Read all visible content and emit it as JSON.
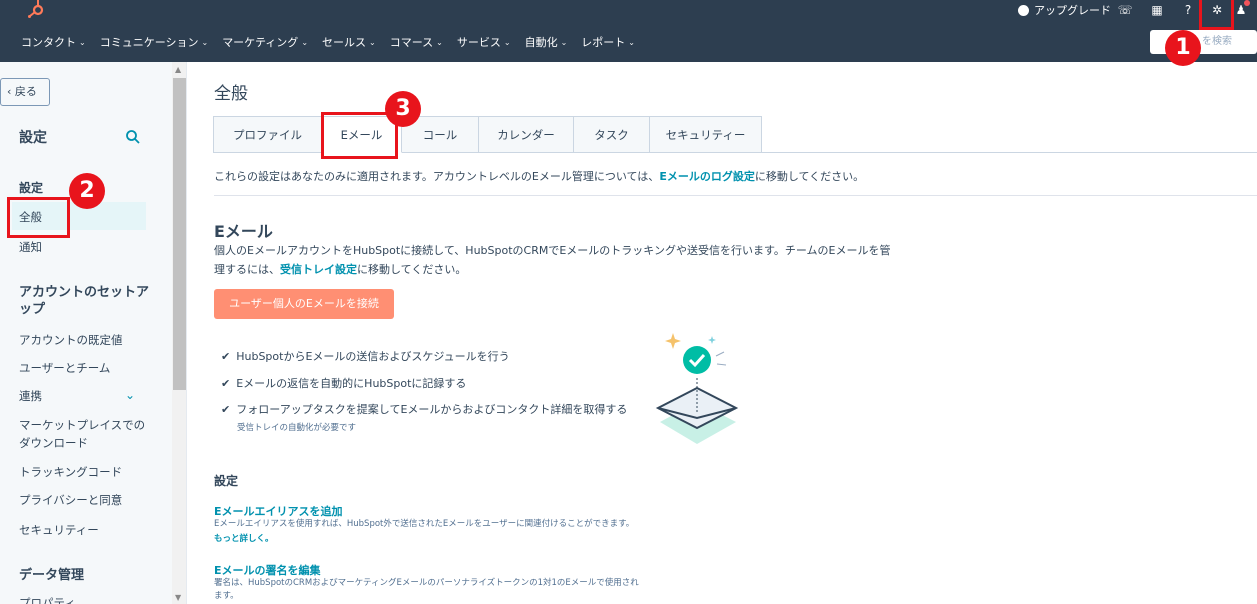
{
  "topbar": {
    "upgrade_label": "アップグレード",
    "search_placeholder": "HubSpotを検索",
    "search_visible": "を検索",
    "nav": [
      "コンタクト",
      "コミュニケーション",
      "マーケティング",
      "セールス",
      "コマース",
      "サービス",
      "自動化",
      "レポート"
    ]
  },
  "sidebar": {
    "back_label": "戻る",
    "title": "設定",
    "section_settings": "設定",
    "item_general": "全般",
    "item_notifications": "通知",
    "section_account_setup": "アカウントのセットアップ",
    "account_items": [
      "アカウントの既定値",
      "ユーザーとチーム",
      "連携",
      "マーケットプレイスでのダウンロード",
      "トラッキングコード",
      "プライバシーと同意",
      "セキュリティー"
    ],
    "section_data": "データ管理",
    "data_items": [
      "プロパティ"
    ]
  },
  "main": {
    "title": "全般",
    "tabs": [
      "プロファイル",
      "Eメール",
      "コール",
      "カレンダー",
      "タスク",
      "セキュリティー"
    ],
    "active_tab": "Eメール",
    "notice_prefix": "これらの設定はあなたのみに適用されます。アカウントレベルのEメール管理については、",
    "notice_link": "Eメールのログ設定",
    "notice_suffix": "に移動してください。",
    "email_heading": "Eメール",
    "email_desc_prefix": "個人のEメールアカウントをHubSpotに接続して、HubSpotのCRMでEメールのトラッキングや送受信を行います。チームのEメールを管理するには、",
    "email_desc_link": "受信トレイ設定",
    "email_desc_suffix": "に移動してください。",
    "connect_button": "ユーザー個人のEメールを接続",
    "features": [
      "HubSpotからEメールの送信およびスケジュールを行う",
      "Eメールの返信を自動的にHubSpotに記録する",
      "フォローアップタスクを提案してEメールからおよびコンタクト詳細を取得する"
    ],
    "feature_note": "受信トレイの自動化が必要です",
    "settings_heading": "設定",
    "alias_title": "Eメールエイリアスを追加",
    "alias_desc": "Eメールエイリアスを使用すれば、HubSpot外で送信されたEメールをユーザーに関連付けることができます。",
    "alias_more": "もっと詳しく。",
    "signature_title": "Eメールの署名を編集",
    "signature_desc_1": "署名は、HubSpotのCRMおよびマーケティングEメールのパーソナライズトークンの1対1のEメールで使用されます。",
    "signature_desc_1_visible": "署名は、HubSpotのCRMおよびマーケティングEメールのパーソナライズトークンの1対1のEメールで使用され",
    "signature_desc_2": "ます。"
  },
  "annotations": {
    "badge_1": "1",
    "badge_2": "2",
    "badge_3": "3"
  },
  "colors": {
    "nav_bg": "#2d3e50",
    "accent": "#ff7a59",
    "link": "#0091ae",
    "annotation_red": "#e8141c"
  }
}
